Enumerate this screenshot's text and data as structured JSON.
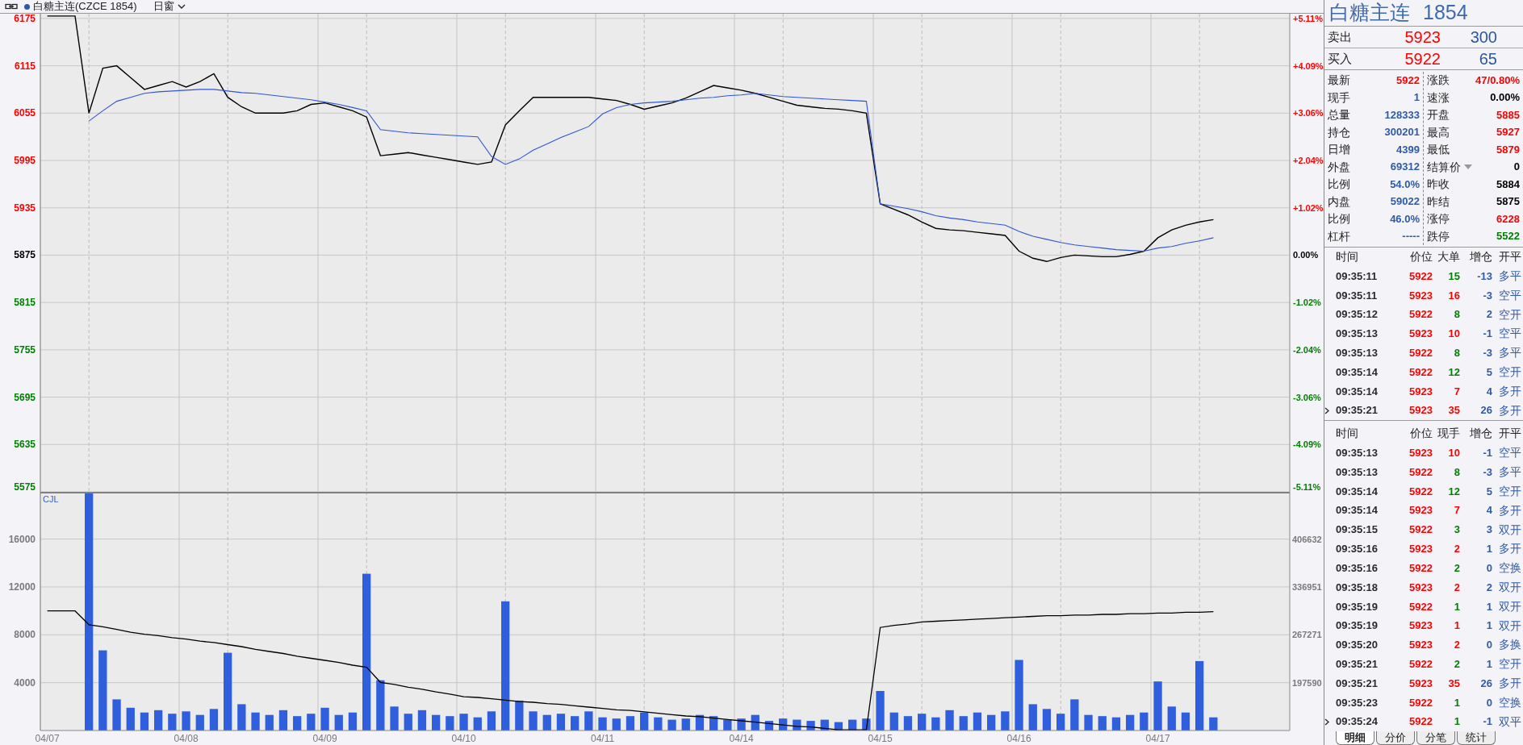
{
  "toolbar": {
    "title": "白糖主连(CZCE 1854)",
    "period": "日窗"
  },
  "price_chart": {
    "chart_data": {
      "type": "line",
      "grid": true,
      "ylim": [
        5575,
        6181
      ],
      "categories": [
        null,
        null,
        null,
        null,
        null,
        null,
        null,
        null,
        null,
        null,
        null,
        null,
        null,
        null,
        null,
        null,
        null,
        null,
        null,
        null,
        null,
        null,
        null,
        null,
        null,
        null,
        null,
        null,
        null,
        null,
        null,
        null,
        null,
        null,
        null,
        null,
        null,
        null,
        null,
        null,
        null,
        null,
        null,
        null,
        null,
        null,
        null,
        null,
        null,
        null,
        null,
        null,
        null,
        null,
        null,
        null,
        null,
        null,
        null,
        null,
        null,
        null,
        null,
        null,
        null,
        null,
        null,
        null,
        null,
        null,
        null,
        null,
        null,
        null,
        null,
        null,
        null,
        null,
        null,
        null,
        null,
        null,
        null,
        null,
        null,
        null,
        null,
        null,
        null,
        null
      ],
      "yticks": [
        {
          "value": 6175,
          "label": "6175"
        },
        {
          "value": 6115,
          "label": "6115"
        },
        {
          "value": 6055,
          "label": "6055"
        },
        {
          "value": 5995,
          "label": "5995"
        },
        {
          "value": 5935,
          "label": "5935"
        },
        {
          "value": 5875,
          "label": "5875"
        },
        {
          "value": 5815,
          "label": "5815"
        },
        {
          "value": 5755,
          "label": "5755"
        },
        {
          "value": 5695,
          "label": "5695"
        },
        {
          "value": 5635,
          "label": "5635"
        },
        {
          "value": 5575,
          "label": "5575"
        }
      ],
      "series": [
        {
          "color": "#000000",
          "values": [
            6178,
            6178,
            6178,
            6055,
            6112,
            6115,
            6100,
            6085,
            6090,
            6095,
            6088,
            6095,
            6105,
            6075,
            6063,
            6055,
            6055,
            6055,
            6058,
            6066,
            6068,
            6063,
            6058,
            6050,
            6001,
            6003,
            6005,
            6002,
            5999,
            5996,
            5993,
            5990,
            5993,
            6040,
            6058,
            6075,
            6075,
            6075,
            6075,
            6075,
            6073,
            6071,
            6066,
            6060,
            6064,
            6068,
            6074,
            6082,
            6090,
            6087,
            6084,
            6080,
            6075,
            6070,
            6065,
            6063,
            6061,
            6060,
            6058,
            6055,
            5940,
            5933,
            5926,
            5917,
            5909,
            5907,
            5906,
            5904,
            5902,
            5900,
            5880,
            5871,
            5867,
            5872,
            5875,
            5874,
            5873,
            5873,
            5876,
            5880,
            5897,
            5907,
            5913,
            5917,
            5920,
            null,
            null,
            null,
            null,
            null
          ]
        },
        {
          "color": "#2f55d4",
          "values": [
            null,
            null,
            null,
            6045,
            6058,
            6070,
            6075,
            6080,
            6082,
            6083,
            6084,
            6085,
            6085,
            6083,
            6081,
            6080,
            6078,
            6076,
            6074,
            6072,
            6069,
            6066,
            6062,
            6058,
            6034,
            6032,
            6030,
            6029,
            6028,
            6027,
            6026,
            6025,
            6000,
            5990,
            5997,
            6008,
            6016,
            6024,
            6031,
            6038,
            6054,
            6062,
            6066,
            6068,
            6069,
            6070,
            6072,
            6074,
            6075,
            6077,
            6078,
            6080,
            6078,
            6076,
            6075,
            6074,
            6073,
            6072,
            6071,
            6070,
            5940,
            5937,
            5934,
            5930,
            5925,
            5922,
            5920,
            5917,
            5915,
            5913,
            5905,
            5899,
            5895,
            5891,
            5888,
            5886,
            5884,
            5882,
            5881,
            5880,
            5884,
            5886,
            5890,
            5893,
            5897,
            null,
            null,
            null,
            null,
            null
          ]
        }
      ]
    },
    "tick_tones": [
      {
        "color": "#ff0000"
      },
      {
        "color": "#ff0000"
      },
      {
        "color": "#ff0000"
      },
      {
        "color": "#ff0000"
      },
      {
        "color": "#ff0000"
      },
      {
        "color": "#000000"
      },
      {
        "color": "#008000"
      },
      {
        "color": "#008000"
      },
      {
        "color": "#008000"
      },
      {
        "color": "#008000"
      },
      {
        "color": "#008000"
      }
    ],
    "right_labels": [
      "+5.11%",
      "+4.09%",
      "+3.06%",
      "+2.04%",
      "+1.02%",
      "0.00%",
      "-1.02%",
      "-2.04%",
      "-3.06%",
      "-4.09%",
      "-5.11%"
    ]
  },
  "volume_chart": {
    "chart_data": {
      "type": "bar",
      "title": "CJL",
      "grid": true,
      "categories": [
        "04/07",
        null,
        null,
        null,
        null,
        null,
        null,
        null,
        null,
        null,
        "04/08",
        null,
        null,
        null,
        null,
        null,
        null,
        null,
        null,
        null,
        "04/09",
        null,
        null,
        null,
        null,
        null,
        null,
        null,
        null,
        null,
        "04/10",
        null,
        null,
        null,
        null,
        null,
        null,
        null,
        null,
        null,
        "04/11",
        null,
        null,
        null,
        null,
        null,
        null,
        null,
        null,
        null,
        "04/14",
        null,
        null,
        null,
        null,
        null,
        null,
        null,
        null,
        null,
        "04/15",
        null,
        null,
        null,
        null,
        null,
        null,
        null,
        null,
        null,
        "04/16",
        null,
        null,
        null,
        null,
        null,
        null,
        null,
        null,
        null,
        "04/17",
        null,
        null,
        null,
        null,
        null,
        null,
        null,
        null,
        null
      ],
      "ylim": [
        0,
        19950
      ],
      "yticks": [
        4000,
        8000,
        12000,
        16000
      ],
      "y2lim": [
        127910,
        475440
      ],
      "y2ticks": [
        197590,
        267271,
        336951,
        406632
      ],
      "series": [
        {
          "color": "#2f5fdc",
          "values": [
            null,
            null,
            null,
            19900,
            6700,
            2600,
            1900,
            1500,
            1700,
            1400,
            1600,
            1300,
            1800,
            6500,
            2200,
            1500,
            1300,
            1700,
            1200,
            1400,
            1900,
            1300,
            1500,
            13100,
            4200,
            2000,
            1400,
            1700,
            1300,
            1200,
            1400,
            1100,
            1600,
            10800,
            2500,
            1600,
            1300,
            1400,
            1200,
            1600,
            1100,
            1000,
            1200,
            1500,
            1100,
            900,
            1000,
            1300,
            1200,
            900,
            1000,
            1300,
            800,
            1000,
            900,
            800,
            900,
            700,
            900,
            1000,
            3300,
            1500,
            1200,
            1400,
            1100,
            1700,
            1200,
            1500,
            1300,
            1600,
            5900,
            2200,
            1800,
            1400,
            2600,
            1300,
            1200,
            1100,
            1300,
            1500,
            4100,
            2000,
            1500,
            5800,
            1100,
            null,
            null,
            null,
            null,
            null
          ]
        },
        {
          "type": "line",
          "color": "#000000",
          "axis": "y2",
          "values": [
            302000,
            302000,
            302000,
            282000,
            279000,
            275000,
            271000,
            268000,
            266000,
            263000,
            261000,
            258000,
            256000,
            253000,
            250000,
            246000,
            243000,
            240000,
            236000,
            233000,
            230000,
            227000,
            223000,
            220000,
            198000,
            195000,
            191000,
            188000,
            184000,
            181000,
            177000,
            176000,
            174000,
            172000,
            170000,
            169000,
            167000,
            166000,
            164000,
            162000,
            160000,
            158000,
            157000,
            155000,
            153000,
            151000,
            149000,
            148000,
            146000,
            144000,
            142000,
            140000,
            138000,
            136000,
            134000,
            133000,
            131000,
            129000,
            129000,
            129000,
            278000,
            281000,
            283000,
            286000,
            287000,
            288000,
            289000,
            290000,
            291000,
            292000,
            293000,
            294000,
            295000,
            295000,
            296000,
            296000,
            297000,
            297000,
            298000,
            298000,
            299000,
            299000,
            300000,
            300000,
            301000,
            null,
            null,
            null,
            null,
            null
          ]
        }
      ]
    }
  },
  "quote": {
    "name": "白糖主连",
    "code": "1854",
    "sell": {
      "label": "卖出",
      "price": "5923",
      "volume": "300"
    },
    "buy": {
      "label": "买入",
      "price": "5922",
      "volume": "65"
    },
    "stats": [
      {
        "left": {
          "label": "最新",
          "value": "5922",
          "color": "#ff0000"
        },
        "right": {
          "label": "涨跌",
          "value": "47/0.80%",
          "color": "#ff0000"
        }
      },
      {
        "left": {
          "label": "现手",
          "value": "1",
          "color": "#2f5aa6"
        },
        "right": {
          "label": "速涨",
          "value": "0.00%",
          "color": "#000000"
        }
      },
      {
        "left": {
          "label": "总量",
          "value": "128333",
          "color": "#2f5aa6"
        },
        "right": {
          "label": "开盘",
          "value": "5885",
          "color": "#ff0000"
        }
      },
      {
        "left": {
          "label": "持仓",
          "value": "300201",
          "color": "#2f5aa6"
        },
        "right": {
          "label": "最高",
          "value": "5927",
          "color": "#ff0000"
        }
      },
      {
        "left": {
          "label": "日增",
          "value": "4399",
          "color": "#2f5aa6"
        },
        "right": {
          "label": "最低",
          "value": "5879",
          "color": "#ff0000"
        }
      },
      {
        "left": {
          "label": "外盘",
          "value": "69312",
          "color": "#2f5aa6"
        },
        "right": {
          "label": "结算价",
          "value": "0",
          "color": "#000000",
          "dropdown": true
        }
      },
      {
        "left": {
          "label": "比例",
          "value": "54.0%",
          "color": "#2f5aa6"
        },
        "right": {
          "label": "昨收",
          "value": "5884",
          "color": "#000000"
        }
      },
      {
        "left": {
          "label": "内盘",
          "value": "59022",
          "color": "#2f5aa6"
        },
        "right": {
          "label": "昨结",
          "value": "5875",
          "color": "#000000"
        }
      },
      {
        "left": {
          "label": "比例",
          "value": "46.0%",
          "color": "#2f5aa6"
        },
        "right": {
          "label": "涨停",
          "value": "6228",
          "color": "#ff0000"
        }
      },
      {
        "left": {
          "label": "杠杆",
          "value": "-----",
          "color": "#2f5aa6"
        },
        "right": {
          "label": "跌停",
          "value": "5522",
          "color": "#008000"
        }
      }
    ]
  },
  "large_trades": {
    "columns": [
      "时间",
      "价位",
      "大单",
      "增仓",
      "开平"
    ],
    "rows": [
      {
        "time": "09:35:11",
        "price": "5922",
        "size": "15",
        "oi_change": "-13",
        "type": "多平",
        "color": "#008000",
        "current": false
      },
      {
        "time": "09:35:11",
        "price": "5923",
        "size": "16",
        "oi_change": "-3",
        "type": "空平",
        "color": "#ff0000",
        "current": false
      },
      {
        "time": "09:35:12",
        "price": "5922",
        "size": "8",
        "oi_change": "2",
        "type": "空开",
        "color": "#008000",
        "current": false
      },
      {
        "time": "09:35:13",
        "price": "5923",
        "size": "10",
        "oi_change": "-1",
        "type": "空平",
        "color": "#ff0000",
        "current": false
      },
      {
        "time": "09:35:13",
        "price": "5922",
        "size": "8",
        "oi_change": "-3",
        "type": "多平",
        "color": "#008000",
        "current": false
      },
      {
        "time": "09:35:14",
        "price": "5922",
        "size": "12",
        "oi_change": "5",
        "type": "空开",
        "color": "#008000",
        "current": false
      },
      {
        "time": "09:35:14",
        "price": "5923",
        "size": "7",
        "oi_change": "4",
        "type": "多开",
        "color": "#ff0000",
        "current": false
      },
      {
        "time": "09:35:21",
        "price": "5923",
        "size": "35",
        "oi_change": "26",
        "type": "多开",
        "color": "#ff0000",
        "current": true
      }
    ]
  },
  "trades": {
    "columns": [
      "时间",
      "价位",
      "现手",
      "增仓",
      "开平"
    ],
    "rows": [
      {
        "time": "09:35:13",
        "price": "5923",
        "size": "10",
        "oi_change": "-1",
        "type": "空平",
        "color": "#ff0000",
        "current": false
      },
      {
        "time": "09:35:13",
        "price": "5922",
        "size": "8",
        "oi_change": "-3",
        "type": "多平",
        "color": "#008000",
        "current": false
      },
      {
        "time": "09:35:14",
        "price": "5922",
        "size": "12",
        "oi_change": "5",
        "type": "空开",
        "color": "#008000",
        "current": false
      },
      {
        "time": "09:35:14",
        "price": "5923",
        "size": "7",
        "oi_change": "4",
        "type": "多开",
        "color": "#ff0000",
        "current": false
      },
      {
        "time": "09:35:15",
        "price": "5922",
        "size": "3",
        "oi_change": "3",
        "type": "双开",
        "color": "#008000",
        "current": false
      },
      {
        "time": "09:35:16",
        "price": "5923",
        "size": "2",
        "oi_change": "1",
        "type": "多开",
        "color": "#ff0000",
        "current": false
      },
      {
        "time": "09:35:16",
        "price": "5922",
        "size": "2",
        "oi_change": "0",
        "type": "空换",
        "color": "#008000",
        "current": false
      },
      {
        "time": "09:35:18",
        "price": "5923",
        "size": "2",
        "oi_change": "2",
        "type": "双开",
        "color": "#ff0000",
        "current": false
      },
      {
        "time": "09:35:19",
        "price": "5922",
        "size": "1",
        "oi_change": "1",
        "type": "双开",
        "color": "#008000",
        "current": false
      },
      {
        "time": "09:35:19",
        "price": "5923",
        "size": "1",
        "oi_change": "1",
        "type": "双开",
        "color": "#ff0000",
        "current": false
      },
      {
        "time": "09:35:20",
        "price": "5923",
        "size": "2",
        "oi_change": "0",
        "type": "多换",
        "color": "#ff0000",
        "current": false
      },
      {
        "time": "09:35:21",
        "price": "5922",
        "size": "2",
        "oi_change": "1",
        "type": "空开",
        "color": "#008000",
        "current": false
      },
      {
        "time": "09:35:21",
        "price": "5923",
        "size": "35",
        "oi_change": "26",
        "type": "多开",
        "color": "#ff0000",
        "current": false
      },
      {
        "time": "09:35:23",
        "price": "5922",
        "size": "1",
        "oi_change": "0",
        "type": "空换",
        "color": "#008000",
        "current": false
      },
      {
        "time": "09:35:24",
        "price": "5922",
        "size": "1",
        "oi_change": "-1",
        "type": "双平",
        "color": "#008000",
        "current": true
      }
    ]
  },
  "tabs": [
    {
      "label": "明细",
      "selected": true
    },
    {
      "label": "分价",
      "selected": false
    },
    {
      "label": "分笔",
      "selected": false
    },
    {
      "label": "统计",
      "selected": false
    }
  ]
}
